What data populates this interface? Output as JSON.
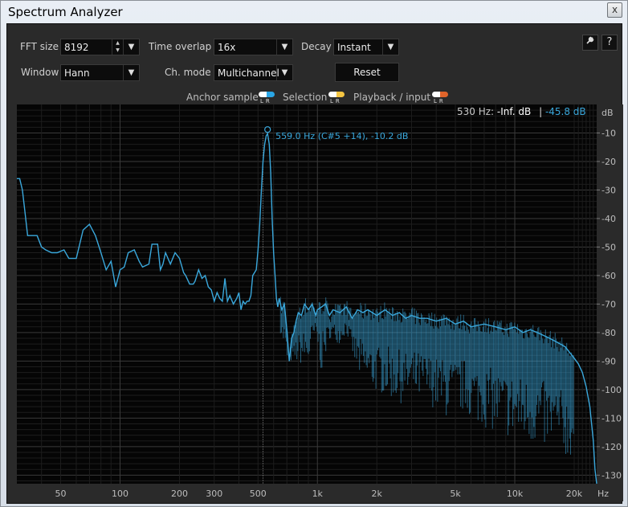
{
  "window": {
    "title": "Spectrum Analyzer",
    "close_label": "x"
  },
  "controls": {
    "fft_size": {
      "label": "FFT size",
      "value": "8192"
    },
    "time_overlap": {
      "label": "Time overlap",
      "value": "16x"
    },
    "decay": {
      "label": "Decay",
      "value": "Instant"
    },
    "window": {
      "label": "Window",
      "value": "Hann"
    },
    "ch_mode": {
      "label": "Ch. mode",
      "value": "Multichannel"
    },
    "reset_label": "Reset",
    "settings_icon": "wrench-icon",
    "help_label": "?"
  },
  "legend": {
    "anchor_sample": "Anchor sample",
    "selection": "Selection",
    "playback_input": "Playback / input",
    "lr": "LR"
  },
  "colors": {
    "anchor_l": "#ffffff",
    "anchor_r": "#2aa6e6",
    "selection_l": "#ffffff",
    "selection_r": "#f4c542",
    "playback_l": "#ffffff",
    "playback_r": "#e0642a",
    "spectrum": "#3aa8dc"
  },
  "readout": {
    "freq": "530 Hz:",
    "left": "-Inf. dB",
    "sep": "|",
    "right": "-45.8 dB"
  },
  "chart_data": {
    "type": "line",
    "xscale": "log",
    "xlim": [
      30,
      26000
    ],
    "ylim": [
      -133,
      0
    ],
    "x_ticks": [
      {
        "v": 50,
        "t": "50"
      },
      {
        "v": 100,
        "t": "100"
      },
      {
        "v": 200,
        "t": "200"
      },
      {
        "v": 300,
        "t": "300"
      },
      {
        "v": 500,
        "t": "500"
      },
      {
        "v": 1000,
        "t": "1k"
      },
      {
        "v": 2000,
        "t": "2k"
      },
      {
        "v": 5000,
        "t": "5k"
      },
      {
        "v": 10000,
        "t": "10k"
      },
      {
        "v": 20000,
        "t": "20k"
      }
    ],
    "x_unit": "Hz",
    "y_ticks": [
      -10,
      -20,
      -30,
      -40,
      -50,
      -60,
      -70,
      -80,
      -90,
      -100,
      -110,
      -120,
      -130
    ],
    "y_unit": "dB",
    "peak": {
      "freq": 559,
      "db": -10.2,
      "label": "559.0 Hz (C#5 +14), -10.2 dB"
    },
    "cursor_freq": 530,
    "series": [
      {
        "points": [
          [
            30,
            -26
          ],
          [
            31,
            -26
          ],
          [
            32,
            -30
          ],
          [
            33,
            -38
          ],
          [
            34,
            -46
          ],
          [
            36,
            -46
          ],
          [
            38,
            -46
          ],
          [
            40,
            -50
          ],
          [
            42,
            -51
          ],
          [
            45,
            -52
          ],
          [
            48,
            -52
          ],
          [
            52,
            -51
          ],
          [
            55,
            -54
          ],
          [
            60,
            -54
          ],
          [
            65,
            -44
          ],
          [
            70,
            -42
          ],
          [
            75,
            -46
          ],
          [
            80,
            -52
          ],
          [
            85,
            -58
          ],
          [
            90,
            -55
          ],
          [
            95,
            -64
          ],
          [
            100,
            -58
          ],
          [
            105,
            -57
          ],
          [
            110,
            -52
          ],
          [
            118,
            -51
          ],
          [
            125,
            -55
          ],
          [
            130,
            -57
          ],
          [
            140,
            -56
          ],
          [
            145,
            -49
          ],
          [
            155,
            -49
          ],
          [
            160,
            -58
          ],
          [
            165,
            -56
          ],
          [
            170,
            -52
          ],
          [
            180,
            -56
          ],
          [
            190,
            -52
          ],
          [
            200,
            -54
          ],
          [
            210,
            -59
          ],
          [
            215,
            -60
          ],
          [
            225,
            -63
          ],
          [
            235,
            -63
          ],
          [
            240,
            -62
          ],
          [
            250,
            -58
          ],
          [
            260,
            -61
          ],
          [
            270,
            -60
          ],
          [
            280,
            -64
          ],
          [
            290,
            -65
          ],
          [
            300,
            -69
          ],
          [
            310,
            -66
          ],
          [
            320,
            -68
          ],
          [
            330,
            -69
          ],
          [
            340,
            -61
          ],
          [
            350,
            -69
          ],
          [
            360,
            -67
          ],
          [
            375,
            -70
          ],
          [
            390,
            -68
          ],
          [
            400,
            -66
          ],
          [
            410,
            -72
          ],
          [
            420,
            -69
          ],
          [
            430,
            -70
          ],
          [
            440,
            -69
          ],
          [
            450,
            -69
          ],
          [
            460,
            -67
          ],
          [
            470,
            -60
          ],
          [
            480,
            -59
          ],
          [
            490,
            -58
          ],
          [
            500,
            -51
          ],
          [
            510,
            -42
          ],
          [
            520,
            -30
          ],
          [
            530,
            -20
          ],
          [
            540,
            -14
          ],
          [
            550,
            -11
          ],
          [
            559,
            -10.2
          ],
          [
            570,
            -14
          ],
          [
            580,
            -24
          ],
          [
            590,
            -40
          ],
          [
            600,
            -52
          ],
          [
            610,
            -60
          ],
          [
            620,
            -68
          ],
          [
            630,
            -71
          ],
          [
            640,
            -68
          ],
          [
            660,
            -72
          ],
          [
            680,
            -70
          ],
          [
            700,
            -79
          ],
          [
            720,
            -90
          ],
          [
            740,
            -82
          ],
          [
            760,
            -80
          ],
          [
            780,
            -76
          ],
          [
            800,
            -73
          ],
          [
            830,
            -74
          ],
          [
            860,
            -70
          ],
          [
            900,
            -72
          ],
          [
            940,
            -70
          ],
          [
            980,
            -74
          ],
          [
            1000,
            -72
          ],
          [
            1050,
            -71
          ],
          [
            1100,
            -70
          ],
          [
            1150,
            -74
          ],
          [
            1200,
            -72
          ],
          [
            1300,
            -73
          ],
          [
            1400,
            -71
          ],
          [
            1500,
            -75
          ],
          [
            1600,
            -72
          ],
          [
            1700,
            -73
          ],
          [
            1800,
            -72
          ],
          [
            2000,
            -74
          ],
          [
            2200,
            -72
          ],
          [
            2400,
            -74
          ],
          [
            2600,
            -73
          ],
          [
            2800,
            -75
          ],
          [
            3000,
            -74
          ],
          [
            3300,
            -75
          ],
          [
            3600,
            -75
          ],
          [
            4000,
            -76
          ],
          [
            4500,
            -75
          ],
          [
            5000,
            -77
          ],
          [
            5500,
            -76
          ],
          [
            6000,
            -78
          ],
          [
            7000,
            -77
          ],
          [
            8000,
            -78
          ],
          [
            9000,
            -79
          ],
          [
            10000,
            -78
          ],
          [
            11000,
            -80
          ],
          [
            12000,
            -79
          ],
          [
            13000,
            -80
          ],
          [
            14000,
            -81
          ],
          [
            15000,
            -82
          ],
          [
            16000,
            -83
          ],
          [
            17000,
            -84
          ],
          [
            18000,
            -85
          ],
          [
            19000,
            -87
          ],
          [
            20000,
            -89
          ],
          [
            21000,
            -91
          ],
          [
            22000,
            -94
          ],
          [
            23000,
            -99
          ],
          [
            24000,
            -106
          ],
          [
            25000,
            -118
          ],
          [
            25500,
            -128
          ],
          [
            26000,
            -133
          ]
        ],
        "troughs": [
          [
            620,
            -74
          ],
          [
            700,
            -90
          ],
          [
            720,
            -90
          ],
          [
            900,
            -92
          ],
          [
            980,
            -80
          ],
          [
            1050,
            -95
          ],
          [
            1150,
            -82
          ],
          [
            1300,
            -84
          ],
          [
            1400,
            -80
          ],
          [
            1600,
            -95
          ],
          [
            1800,
            -100
          ],
          [
            2200,
            -102
          ],
          [
            2600,
            -105
          ],
          [
            3200,
            -104
          ],
          [
            3800,
            -106
          ],
          [
            4500,
            -110
          ],
          [
            5500,
            -108
          ],
          [
            6500,
            -112
          ],
          [
            8000,
            -115
          ],
          [
            10000,
            -118
          ],
          [
            13000,
            -120
          ],
          [
            16000,
            -122
          ],
          [
            20000,
            -125
          ]
        ]
      }
    ]
  }
}
